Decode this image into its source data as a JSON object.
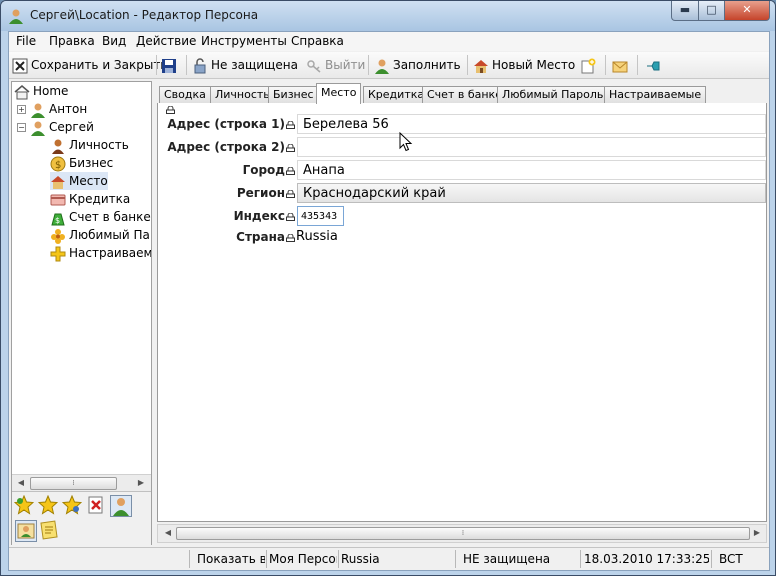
{
  "window": {
    "title": "Сергей\\Location - Редактор Персона"
  },
  "menu": [
    "File",
    "Правка",
    "Вид",
    "Действие",
    "Инструменты",
    "Справка"
  ],
  "toolbar": {
    "save_close": "Сохранить и Закрыть",
    "protection": "Не защищена",
    "logout": "Выйти",
    "fill": "Заполнить",
    "new_place": "Новый Место"
  },
  "tree": {
    "root": "Home",
    "nodes": [
      "Антон",
      "Сергей"
    ],
    "children": [
      "Личность",
      "Бизнес",
      "Место",
      "Кредитка",
      "Счет в банке",
      "Любимый Па",
      "Настраиваем"
    ]
  },
  "tabs": [
    "Сводка",
    "Личность",
    "Бизнес",
    "Место",
    "Кредитка",
    "Счет в банке",
    "Любимый Пароль",
    "Настраиваемые"
  ],
  "form": {
    "address1": {
      "label": "Адрес (строка 1)",
      "value": "Берелева 56"
    },
    "address2": {
      "label": "Адрес (строка 2)",
      "value": ""
    },
    "city": {
      "label": "Город",
      "value": "Анапа"
    },
    "region": {
      "label": "Регион",
      "value": "Краснодарский край"
    },
    "zip": {
      "label": "Индекс",
      "value": "435343"
    },
    "country": {
      "label": "Страна",
      "value": "Russia"
    }
  },
  "status": {
    "show": "Показать вс",
    "vault": "Моя Персон",
    "country": "Russia",
    "protection": "НЕ защищена",
    "datetime": "18.03.2010 17:33:25",
    "mode": "BCT"
  },
  "colors": {
    "accent": "#2a6fbf",
    "window_frame": "#bcd3ea",
    "active_tab": "#ffffff"
  }
}
